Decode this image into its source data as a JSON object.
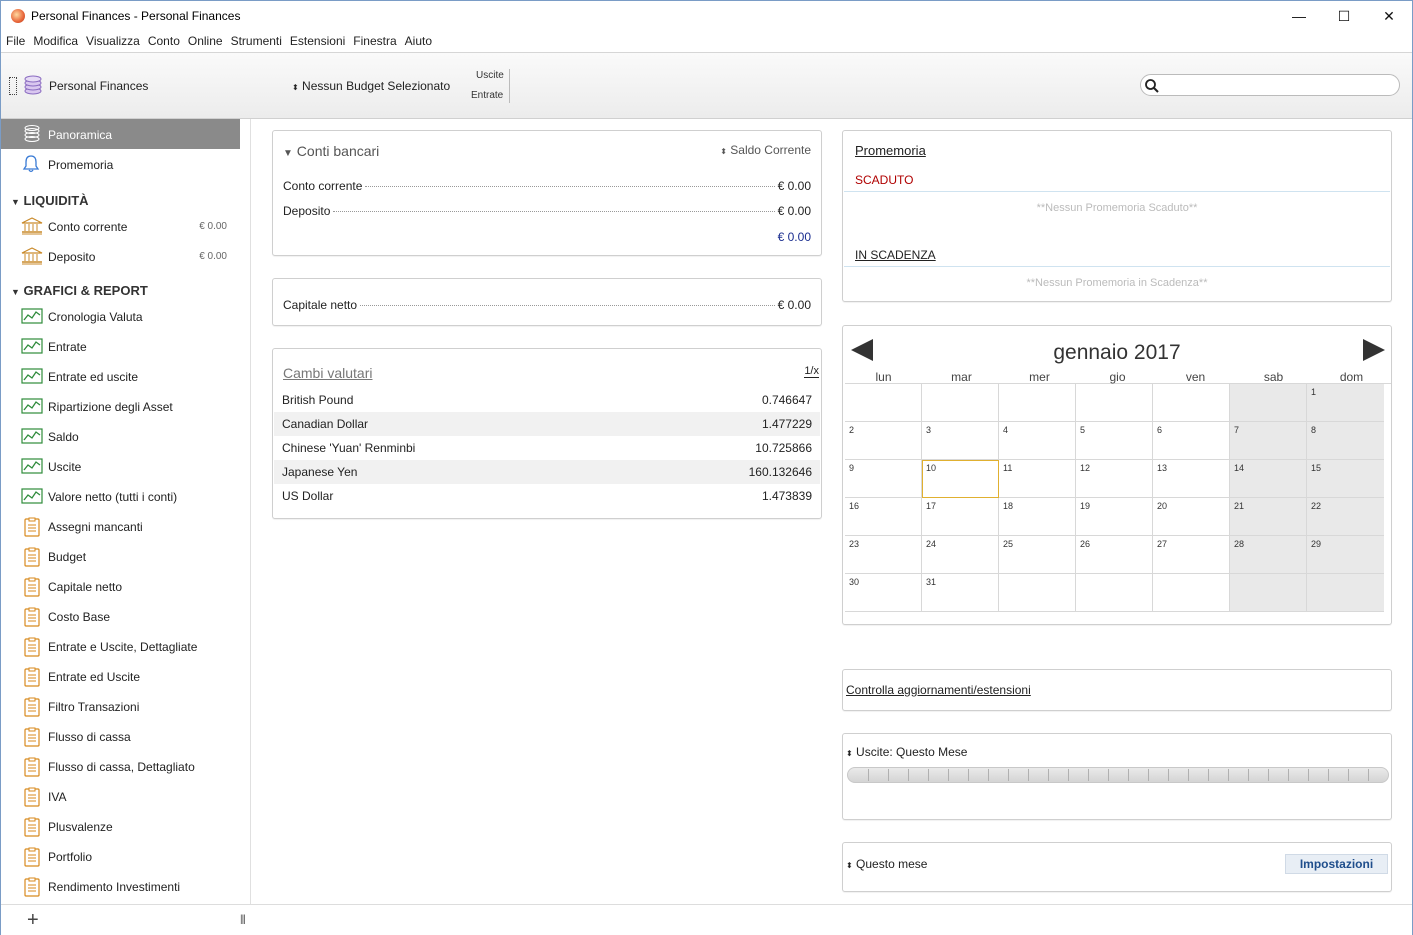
{
  "window": {
    "title": "Personal Finances - Personal Finances",
    "minimize": "—",
    "maximize": "☐",
    "close": "✕"
  },
  "menu": [
    "File",
    "Modifica",
    "Visualizza",
    "Conto",
    "Online",
    "Strumenti",
    "Estensioni",
    "Finestra",
    "Aiuto"
  ],
  "toolbar": {
    "account_name": "Personal Finances",
    "budget_label": "Nessun Budget Selezionato",
    "legend_out": "Uscite",
    "legend_in": "Entrate",
    "search_placeholder": ""
  },
  "sidebar": {
    "top": [
      {
        "label": "Panoramica",
        "icon": "stack-icon",
        "selected": true
      },
      {
        "label": "Promemoria",
        "icon": "bell-icon",
        "selected": false
      }
    ],
    "liquidity_header": "LIQUIDITÀ",
    "accounts": [
      {
        "label": "Conto corrente",
        "amount": "€ 0.00"
      },
      {
        "label": "Deposito",
        "amount": "€ 0.00"
      }
    ],
    "reports_header": "GRAFICI & REPORT",
    "graphs": [
      "Cronologia Valuta",
      "Entrate",
      "Entrate ed uscite",
      "Ripartizione degli Asset",
      "Saldo",
      "Uscite",
      "Valore netto (tutti i conti)"
    ],
    "reports": [
      "Assegni mancanti",
      "Budget",
      "Capitale netto",
      "Costo Base",
      "Entrate e Uscite, Dettagliate",
      "Entrate ed Uscite",
      "Filtro Transazioni",
      "Flusso di cassa",
      "Flusso di cassa, Dettagliato",
      "IVA",
      "Plusvalenze",
      "Portfolio",
      "Rendimento Investimenti"
    ]
  },
  "bank_accounts": {
    "title": "Conti bancari",
    "balance_selector": "Saldo Corrente",
    "rows": [
      {
        "label": "Conto corrente",
        "value": "€ 0.00"
      },
      {
        "label": "Deposito",
        "value": "€ 0.00"
      }
    ],
    "total": "€ 0.00"
  },
  "net_worth": {
    "label": "Capitale netto",
    "value": "€ 0.00"
  },
  "exchange": {
    "title": "Cambi valutari",
    "toggle": "1/x",
    "rows": [
      {
        "name": "British Pound",
        "value": "0.746647"
      },
      {
        "name": "Canadian Dollar",
        "value": "1.477229"
      },
      {
        "name": "Chinese 'Yuan' Renminbi",
        "value": "10.725866"
      },
      {
        "name": "Japanese Yen",
        "value": "160.132646"
      },
      {
        "name": "US Dollar",
        "value": "1.473839"
      }
    ]
  },
  "reminders": {
    "title": "Promemoria",
    "overdue_label": "SCADUTO",
    "overdue_empty": "**Nessun Promemoria Scaduto**",
    "upcoming_label": "IN SCADENZA",
    "upcoming_empty": "**Nessun Promemoria in Scadenza**"
  },
  "calendar": {
    "month": "gennaio 2017",
    "weekdays": [
      "lun",
      "mar",
      "mer",
      "gio",
      "ven",
      "sab",
      "dom"
    ],
    "today": 10,
    "weeks": [
      [
        "",
        "",
        "",
        "",
        "",
        "",
        "1"
      ],
      [
        "2",
        "3",
        "4",
        "5",
        "6",
        "7",
        "8"
      ],
      [
        "9",
        "10",
        "11",
        "12",
        "13",
        "14",
        "15"
      ],
      [
        "16",
        "17",
        "18",
        "19",
        "20",
        "21",
        "22"
      ],
      [
        "23",
        "24",
        "25",
        "26",
        "27",
        "28",
        "29"
      ],
      [
        "30",
        "31",
        "",
        "",
        "",
        "",
        ""
      ]
    ]
  },
  "updates": {
    "link": "Controlla aggiornamenti/estensioni"
  },
  "spending": {
    "label": "Uscite: Questo Mese"
  },
  "this_month": {
    "label": "Questo mese",
    "settings_button": "Impostazioni"
  },
  "bottombar": {
    "add": "+",
    "grip": "|||"
  },
  "colors": {
    "selected_bg": "#8a8a8a",
    "overdue": "#b00000",
    "total": "#1a2d8f",
    "settings": "#1f4e8c"
  }
}
